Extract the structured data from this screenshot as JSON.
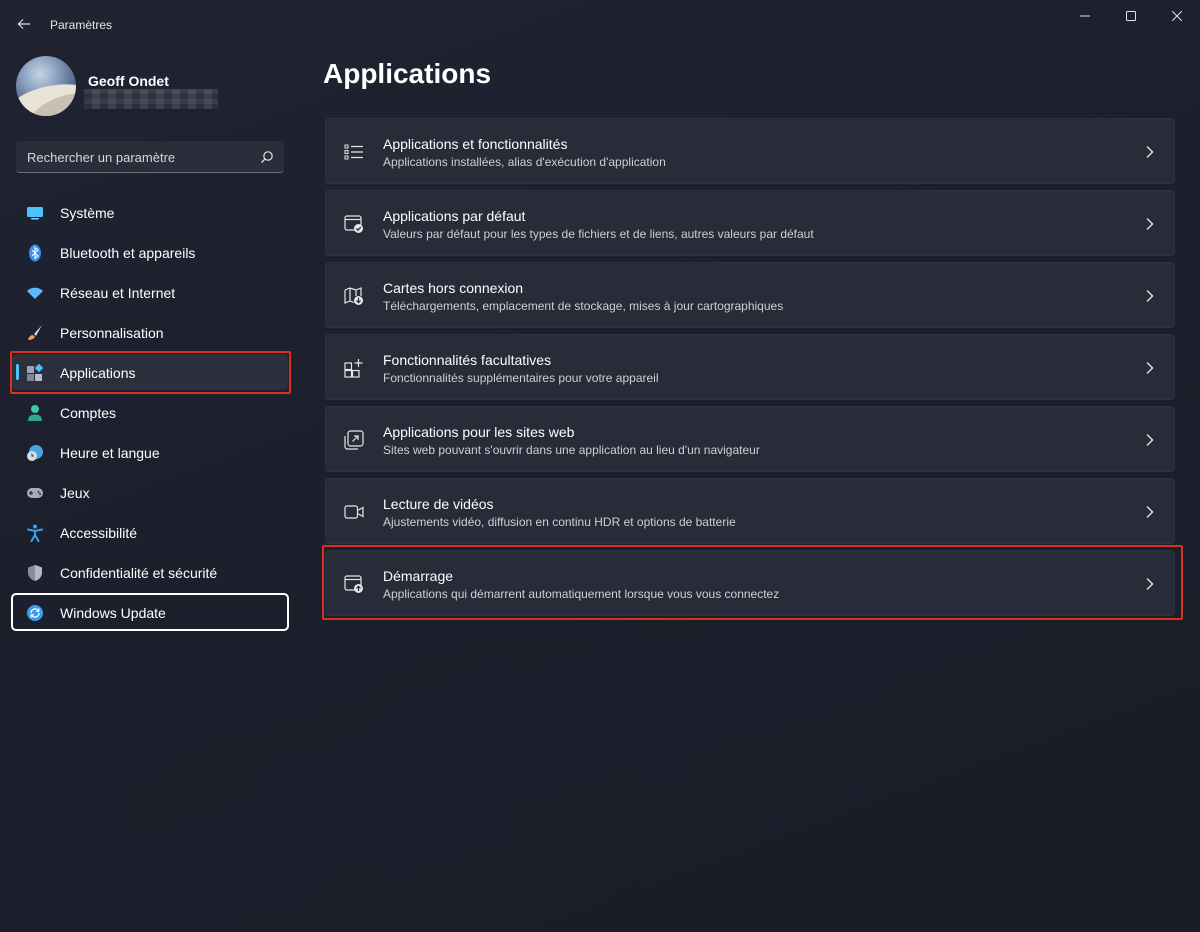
{
  "window": {
    "title": "Paramètres",
    "back_icon": "back-arrow-icon",
    "controls": [
      "minimize-icon",
      "maximize-icon",
      "close-icon"
    ]
  },
  "profile": {
    "name": "Geoff Ondet"
  },
  "search": {
    "placeholder": "Rechercher un paramètre",
    "icon": "search-icon"
  },
  "sidebar": {
    "items": [
      {
        "label": "Système",
        "icon": "monitor-icon",
        "color": "#4cc2ff"
      },
      {
        "label": "Bluetooth et appareils",
        "icon": "bluetooth-icon",
        "color": "#3a8ef0"
      },
      {
        "label": "Réseau et Internet",
        "icon": "wifi-icon",
        "color": "#5cb8ff"
      },
      {
        "label": "Personnalisation",
        "icon": "brush-icon",
        "color": "#e8a25c"
      },
      {
        "label": "Applications",
        "icon": "apps-icon",
        "color": "#9aa3b8",
        "active": true
      },
      {
        "label": "Comptes",
        "icon": "person-icon",
        "color": "#3cc8a0"
      },
      {
        "label": "Heure et langue",
        "icon": "clock-globe-icon",
        "color": "#4aa3e0"
      },
      {
        "label": "Jeux",
        "icon": "gamepad-icon",
        "color": "#a8acb8"
      },
      {
        "label": "Accessibilité",
        "icon": "accessibility-icon",
        "color": "#3aa0f0"
      },
      {
        "label": "Confidentialité et sécurité",
        "icon": "shield-icon",
        "color": "#8a8e9a"
      },
      {
        "label": "Windows Update",
        "icon": "update-icon",
        "color": "#3a9ef0"
      }
    ]
  },
  "main": {
    "title": "Applications",
    "cards": [
      {
        "title": "Applications et fonctionnalités",
        "desc": "Applications installées, alias d'exécution d'application",
        "icon": "list-icon"
      },
      {
        "title": "Applications par défaut",
        "desc": "Valeurs par défaut pour les types de fichiers et de liens, autres valeurs par défaut",
        "icon": "default-apps-icon"
      },
      {
        "title": "Cartes hors connexion",
        "desc": "Téléchargements, emplacement de stockage, mises à jour cartographiques",
        "icon": "map-download-icon"
      },
      {
        "title": "Fonctionnalités facultatives",
        "desc": "Fonctionnalités supplémentaires pour votre appareil",
        "icon": "add-grid-icon"
      },
      {
        "title": "Applications pour les sites web",
        "desc": "Sites web pouvant s'ouvrir dans une application au lieu d'un navigateur",
        "icon": "open-in-app-icon"
      },
      {
        "title": "Lecture de vidéos",
        "desc": "Ajustements vidéo, diffusion en continu HDR et options de batterie",
        "icon": "video-camera-icon"
      },
      {
        "title": "Démarrage",
        "desc": "Applications qui démarrent automatiquement lorsque vous vous connectez",
        "icon": "startup-icon"
      }
    ]
  },
  "colors": {
    "accent": "#4cc2ff",
    "highlight": "#d9301f"
  }
}
